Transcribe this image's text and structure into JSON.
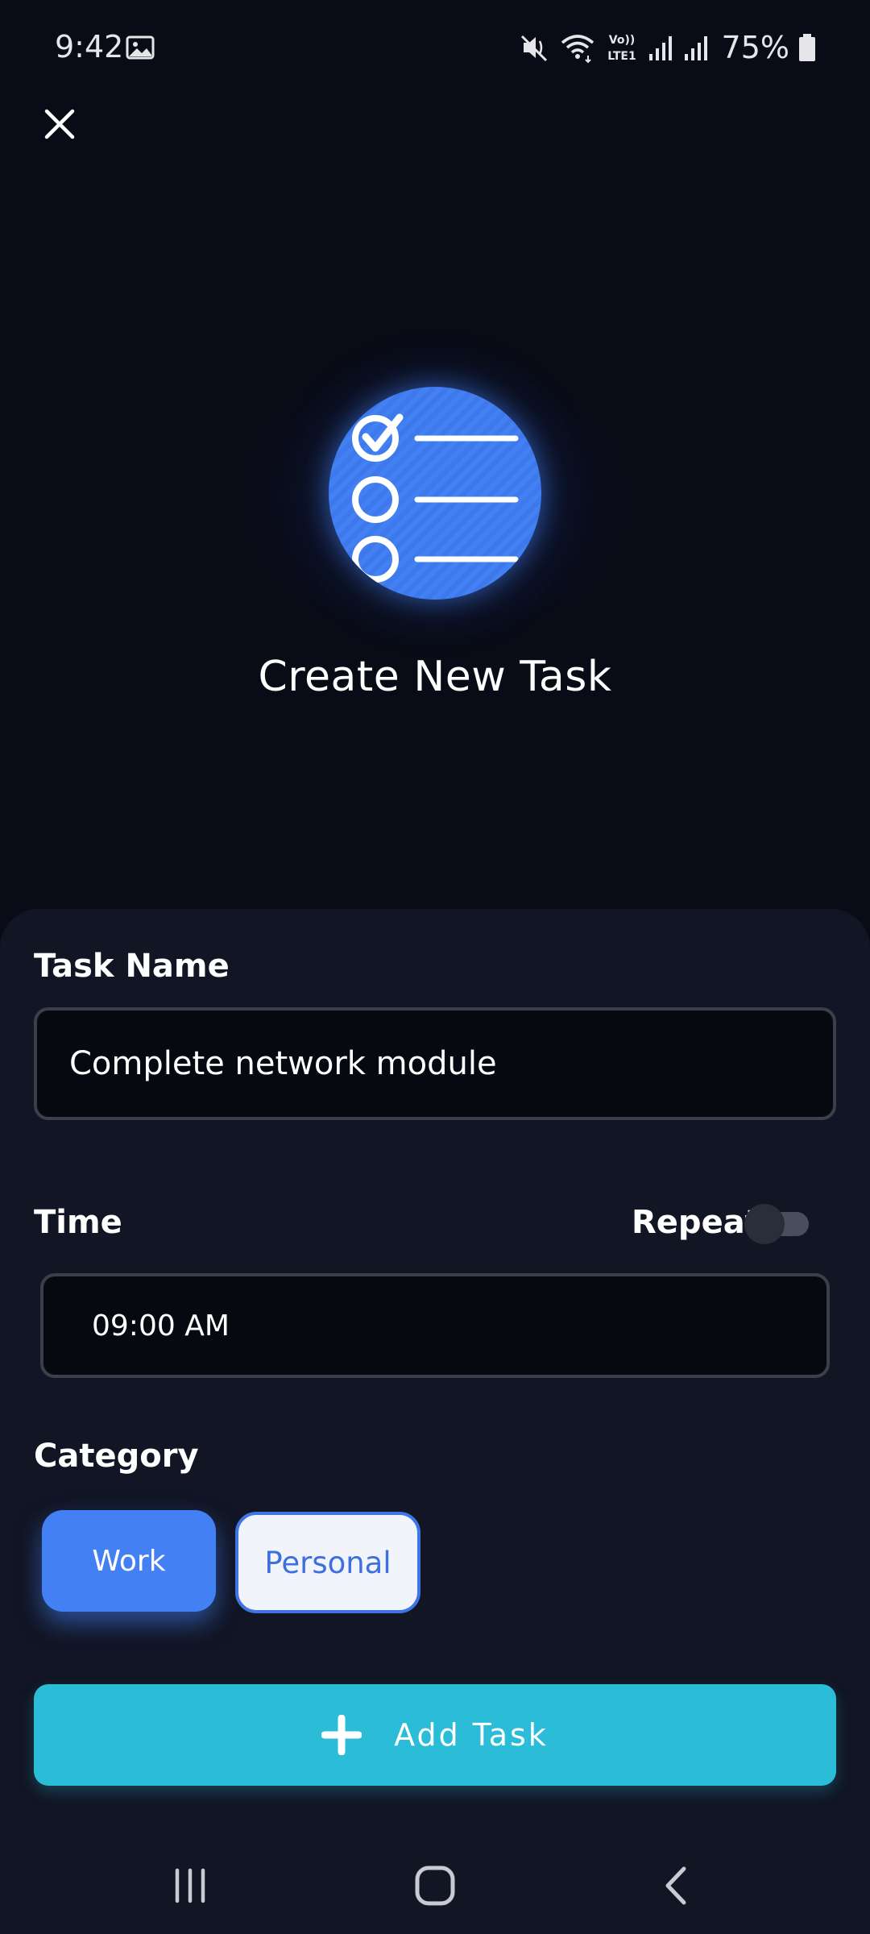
{
  "status_bar": {
    "time": "9:42",
    "battery": "75%",
    "icons": [
      "gallery-icon",
      "mute-icon",
      "wifi-icon",
      "volte-icon",
      "signal-icon",
      "battery-icon"
    ],
    "volte_top": "Vo))",
    "volte_bottom": "LTE1"
  },
  "header": {
    "close_icon": "close-icon",
    "hero_icon": "checklist-icon",
    "title": "Create New Task"
  },
  "form": {
    "task_name": {
      "label": "Task Name",
      "value": "Complete network module"
    },
    "time": {
      "label": "Time",
      "value": "09:00 AM"
    },
    "repeat": {
      "label": "Repeat",
      "enabled": false
    },
    "category": {
      "label": "Category",
      "options": [
        "Work",
        "Personal"
      ],
      "selected": "Work"
    },
    "submit": {
      "label": "Add Task",
      "icon": "plus-icon"
    }
  },
  "nav_bar": {
    "buttons": [
      "recent-apps-icon",
      "home-icon",
      "back-icon"
    ]
  },
  "colors": {
    "background": "#090b16",
    "panel": "#111524",
    "accent_blue": "#4280f3",
    "accent_cyan": "#2bbcd8",
    "chip_light": "#f1f5fb"
  }
}
